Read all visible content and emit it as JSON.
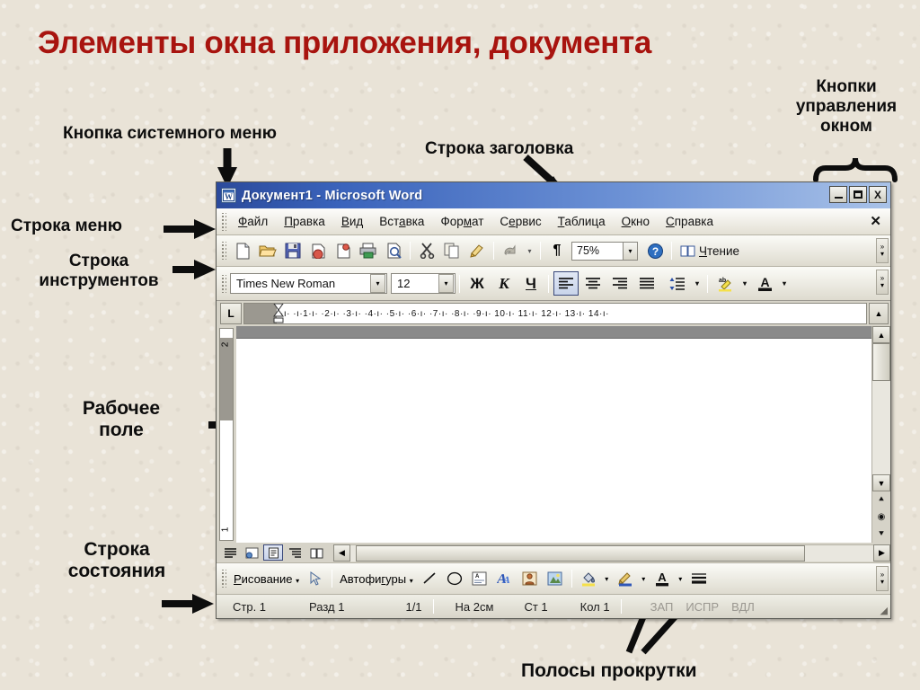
{
  "slide": {
    "title_part1": "Элементы окна",
    "title_part2": " приложения, документа",
    "title_color": "#a8140f",
    "background_color": "#e9e3d7"
  },
  "annotations": {
    "system_menu_button": "Кнопка системного меню",
    "title_bar": "Строка заголовка",
    "window_control_buttons_l1": "Кнопки",
    "window_control_buttons_l2": "управления",
    "window_control_buttons_l3": "окном",
    "menu_bar": "Строка меню",
    "toolbars_l1": "Строка",
    "toolbars_l2": "инструментов",
    "work_area_l1": "Рабочее",
    "work_area_l2": "поле",
    "status_bar_l1": "Строка",
    "status_bar_l2": "состояния",
    "scrollbars": "Полосы прокрутки"
  },
  "window": {
    "titlebar": {
      "app_icon": "word-document-icon",
      "title": "Документ1 - Microsoft Word",
      "minimize": "_",
      "maximize": "□",
      "close": "X"
    },
    "menubar": {
      "items": [
        {
          "pre": "",
          "u": "Ф",
          "post": "айл"
        },
        {
          "pre": "",
          "u": "П",
          "post": "равка"
        },
        {
          "pre": "",
          "u": "В",
          "post": "ид"
        },
        {
          "pre": "Вст",
          "u": "а",
          "post": "вка"
        },
        {
          "pre": "Фор",
          "u": "м",
          "post": "ат"
        },
        {
          "pre": "С",
          "u": "е",
          "post": "рвис"
        },
        {
          "pre": "",
          "u": "Т",
          "post": "аблица"
        },
        {
          "pre": "",
          "u": "О",
          "post": "кно"
        },
        {
          "pre": "",
          "u": "С",
          "post": "правка"
        }
      ],
      "close_document": "✕"
    },
    "standard_toolbar": {
      "buttons": [
        "new-document-icon",
        "open-folder-icon",
        "save-disk-icon",
        "mail-icon",
        "permission-icon",
        "print-icon",
        "print-preview-icon",
        "cut-scissors-icon",
        "copy-icon",
        "format-painter-icon",
        "undo-icon",
        "undo-dropdown-icon",
        "show-formatting-marks-icon"
      ],
      "zoom_value": "75%",
      "zoom_dropdown": "▾",
      "help_icon": "help-question-icon",
      "reading_pre": "",
      "reading_u": "Ч",
      "reading_post": "тение",
      "overflow": "»"
    },
    "formatting_toolbar": {
      "font_name": "Times New Roman",
      "font_size": "12",
      "bold": "Ж",
      "italic": "К",
      "underline": "Ч",
      "align_left": "align-left-icon",
      "align_center": "align-center-icon",
      "align_right": "align-right-icon",
      "align_justify": "align-justify-icon",
      "line_spacing": "line-spacing-icon",
      "highlight": "highlight-icon",
      "font_color": "А",
      "overflow": "»"
    },
    "ruler": {
      "tab_selector": "L",
      "marks": "·ı· ·ı·1·ı· ·2·ı· ·3·ı· ·4·ı· ·5·ı· ·6·ı· ·7·ı· ·8·ı· ·9·ı· 10·ı· 11·ı· 12·ı· 13·ı· 14·ı·",
      "vertical_top": "2",
      "vertical_bottom": "1"
    },
    "scrollbars": {
      "v_up": "▲",
      "v_down": "▼",
      "browse_prev": "⯅",
      "browse_select": "◉",
      "browse_next": "⯆",
      "h_left": "◀",
      "h_right": "▶"
    },
    "view_buttons": [
      {
        "name": "normal-view",
        "glyph": "≣",
        "active": false
      },
      {
        "name": "web-layout-view",
        "glyph": "🗔",
        "active": false
      },
      {
        "name": "print-layout-view",
        "glyph": "▤",
        "active": true
      },
      {
        "name": "outline-view",
        "glyph": "⁝≡",
        "active": false
      },
      {
        "name": "reading-layout-view",
        "glyph": "📖",
        "active": false
      }
    ],
    "drawing_toolbar": {
      "menu_pre": "",
      "menu_u": "Р",
      "menu_post": "исование",
      "menu_arrow": "▾",
      "select_icon": "select-arrow-icon",
      "autoshapes_pre": "Автофи",
      "autoshapes_u": "г",
      "autoshapes_post": "уры",
      "autoshapes_arrow": "▾",
      "buttons": [
        "line-icon",
        "oval-icon",
        "text-box-icon",
        "wordart-icon",
        "diagram-icon",
        "picture-icon",
        "fill-color-icon",
        "fill-dropdown",
        "line-color-icon",
        "line-color-dropdown",
        "font-color-icon",
        "font-color-dropdown",
        "line-style-icon"
      ],
      "overflow": "»"
    },
    "statusbar": {
      "page": "Стр. 1",
      "section": "Разд 1",
      "pages": "1/1",
      "at": "На 2см",
      "line": "Ст 1",
      "column": "Кол 1",
      "rec": "ЗАП",
      "trk": "ИСПР",
      "ext": "ВДЛ",
      "resizer": "◢"
    }
  }
}
